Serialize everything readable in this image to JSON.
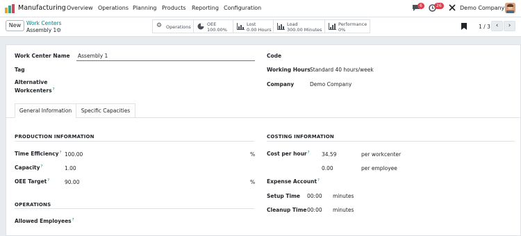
{
  "navbar": {
    "app_name": "Manufacturing",
    "menu": [
      "Overview",
      "Operations",
      "Planning",
      "Products",
      "Reporting",
      "Configuration"
    ],
    "messages_badge": "6",
    "activities_badge": "26",
    "company": "Demo Company"
  },
  "control": {
    "new_label": "New",
    "breadcrumb_parent": "Work Centers",
    "breadcrumb_current": "Assembly 1",
    "smart_buttons": {
      "operations": "Operations",
      "oee_label": "OEE",
      "oee_value": "100.00%",
      "lost_label": "Lost",
      "lost_value": "0.00 Hours",
      "load_label": "Load",
      "load_value": "300.00 Minutes",
      "performance_label": "Performance",
      "performance_value": "0%"
    },
    "pager": "1 / 3"
  },
  "form": {
    "work_center_name_label": "Work Center Name",
    "work_center_name_value": "Assembly 1",
    "tag_label": "Tag",
    "alt_workcenters_label_1": "Alternative",
    "alt_workcenters_label_2": "Workcenters",
    "code_label": "Code",
    "working_hours_label": "Working Hours",
    "working_hours_value": "Standard 40 hours/week",
    "company_label": "Company",
    "company_value": "Demo Company",
    "tabs": [
      "General Information",
      "Specific Capacities"
    ],
    "production_info": {
      "title": "PRODUCTION INFORMATION",
      "time_efficiency_label": "Time Efficiency",
      "time_efficiency_value": "100.00",
      "percent": "%",
      "capacity_label": "Capacity",
      "capacity_value": "1.00",
      "oee_target_label": "OEE Target",
      "oee_target_value": "90.00"
    },
    "operations": {
      "title": "OPERATIONS",
      "allowed_employees_label": "Allowed Employees"
    },
    "costing_info": {
      "title": "COSTING INFORMATION",
      "cost_per_hour_label": "Cost per hour",
      "cost_workcenter_value": "34.59",
      "cost_workcenter_unit": "per workcenter",
      "cost_employee_value": "0.00",
      "cost_employee_unit": "per employee",
      "expense_account_label": "Expense Account",
      "setup_time_label": "Setup Time",
      "setup_time_value": "00:00",
      "setup_time_unit": "minutes",
      "cleanup_time_label": "Cleanup Time",
      "cleanup_time_value": "00:00",
      "cleanup_time_unit": "minutes"
    },
    "help_mark": "?"
  }
}
